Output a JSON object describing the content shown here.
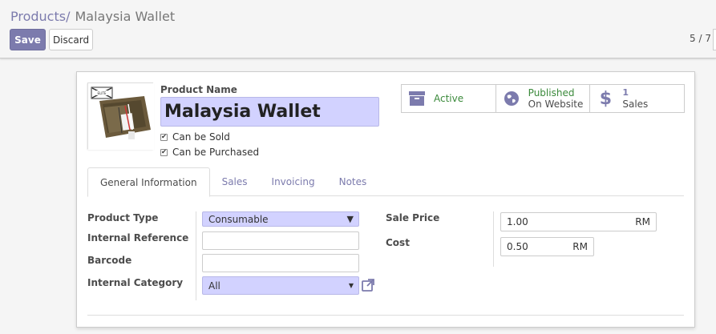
{
  "breadcrumb": {
    "parent": "Products",
    "separator": "/",
    "current": "Malaysia Wallet"
  },
  "buttons": {
    "save": "Save",
    "discard": "Discard"
  },
  "pager": {
    "text": "5 / 7"
  },
  "product": {
    "name_label": "Product Name",
    "name": "Malaysia Wallet",
    "can_be_sold_label": "Can be Sold",
    "can_be_purchased_label": "Can be Purchased",
    "image_logo_text": "ELITE"
  },
  "smart_buttons": [
    {
      "icon": "archive-icon",
      "line1": "Active",
      "line2": ""
    },
    {
      "icon": "globe-icon",
      "line1": "Published",
      "line2": "On Website"
    },
    {
      "icon": "dollar-icon",
      "line1": "1",
      "line2": "Sales"
    }
  ],
  "tabs": [
    {
      "label": "General Information",
      "active": true
    },
    {
      "label": "Sales",
      "active": false
    },
    {
      "label": "Invoicing",
      "active": false
    },
    {
      "label": "Notes",
      "active": false
    }
  ],
  "form": {
    "product_type_label": "Product Type",
    "product_type_value": "Consumable",
    "internal_reference_label": "Internal Reference",
    "internal_reference_value": "",
    "barcode_label": "Barcode",
    "barcode_value": "",
    "internal_category_label": "Internal Category",
    "internal_category_value": "All",
    "sale_price_label": "Sale Price",
    "sale_price_value": "1.00",
    "cost_label": "Cost",
    "cost_value": "0.50",
    "currency": "RM"
  },
  "colors": {
    "accent": "#7c7bad",
    "required_field": "#d2d2ff",
    "active_green": "#3b8a3b"
  }
}
